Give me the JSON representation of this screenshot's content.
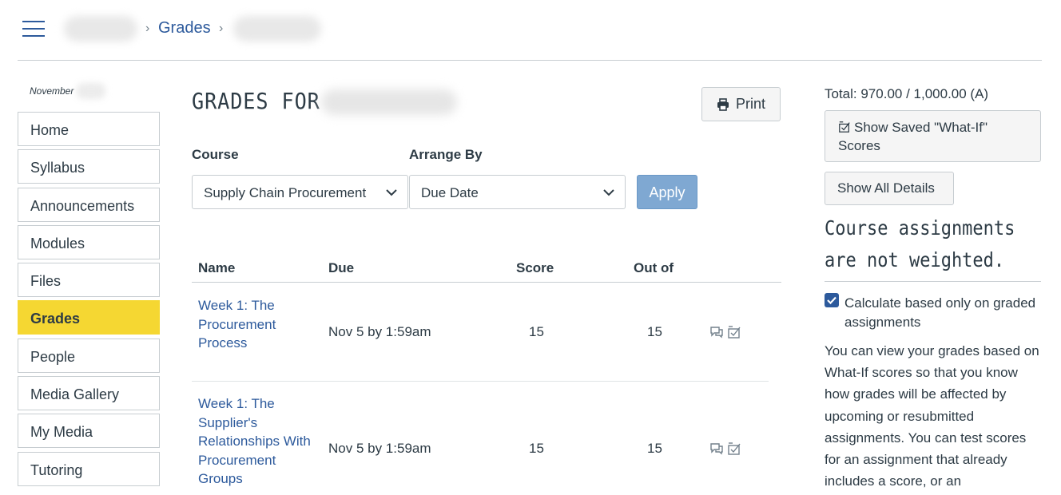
{
  "breadcrumb": {
    "current": "Grades",
    "separator": "›"
  },
  "nav": {
    "date": "November",
    "items": [
      {
        "label": "Home",
        "active": false
      },
      {
        "label": "Syllabus",
        "active": false
      },
      {
        "label": "Announcements",
        "active": false
      },
      {
        "label": "Modules",
        "active": false
      },
      {
        "label": "Files",
        "active": false
      },
      {
        "label": "Grades",
        "active": true
      },
      {
        "label": "People",
        "active": false
      },
      {
        "label": "Media Gallery",
        "active": false
      },
      {
        "label": "My Media",
        "active": false
      },
      {
        "label": "Tutoring",
        "active": false
      }
    ]
  },
  "main": {
    "title": "GRADES FOR",
    "print_label": "Print",
    "course_label": "Course",
    "course_value": "Supply Chain Procurement",
    "arrange_label": "Arrange By",
    "arrange_value": "Due Date",
    "apply_label": "Apply",
    "columns": [
      "Name",
      "Due",
      "Score",
      "Out of"
    ],
    "rows": [
      {
        "name": "Week 1: The Procurement Process",
        "due": "Nov 5 by 1:59am",
        "score": "15",
        "out_of": "15"
      },
      {
        "name": "Week 1: The Supplier's Relationships With Procurement Groups",
        "due": "Nov 5 by 1:59am",
        "score": "15",
        "out_of": "15"
      }
    ]
  },
  "sidebar_right": {
    "total": "Total: 970.00 / 1,000.00 (A)",
    "whatif_label": "Show Saved \"What-If\" Scores",
    "details_label": "Show All Details",
    "weighted_note": "Course assignments are not weighted.",
    "checkbox_label": "Calculate based only on graded assignments",
    "checkbox_checked": true,
    "info": "You can view your grades based on What-If scores so that you know how grades will be affected by upcoming or resubmitted assignments. You can test scores for an assignment that already includes a score, or an"
  },
  "colors": {
    "link": "#2d5a9c",
    "active_nav": "#f5d732",
    "apply": "#7fa8d2",
    "text": "#2d3b45",
    "border": "#c7cdd1"
  },
  "icons": [
    "hamburger-icon",
    "print-icon",
    "chevron-down-icon",
    "comment-icon",
    "whatif-icon",
    "checkmark-icon"
  ]
}
